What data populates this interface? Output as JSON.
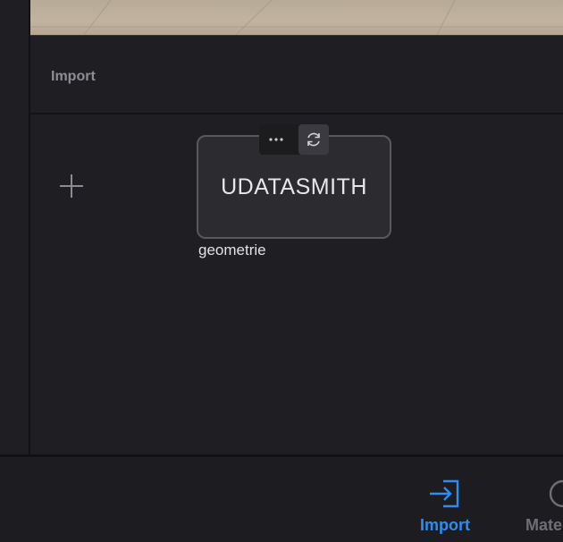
{
  "import_section": {
    "header_label": "Import"
  },
  "file_card": {
    "type_label": "UDATASMITH",
    "file_name": "geometrie",
    "actions": {
      "more": "more-options-icon",
      "refresh": "refresh-icon"
    }
  },
  "add_button": {
    "icon": "plus-icon"
  },
  "bottom_nav": {
    "items": [
      {
        "label": "Import",
        "icon": "import-arrow-icon",
        "active": true
      },
      {
        "label": "Mate",
        "icon": "materials-circle-icon",
        "active": false
      }
    ]
  },
  "colors": {
    "accent": "#2f8cf0",
    "background": "#1f1f23",
    "card": "#2b2b30",
    "card_border": "#58585e"
  }
}
